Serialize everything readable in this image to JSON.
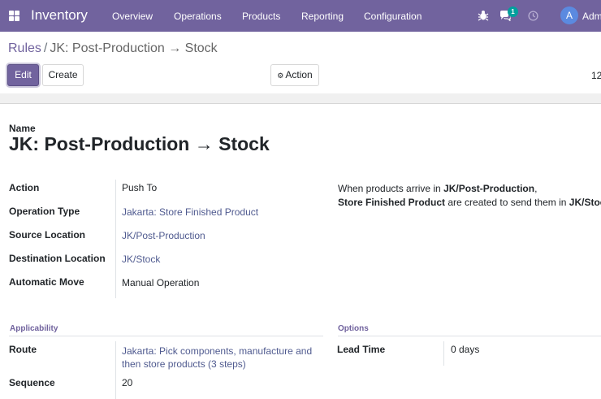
{
  "topbar": {
    "app_name": "Inventory",
    "menu": [
      "Overview",
      "Operations",
      "Products",
      "Reporting",
      "Configuration"
    ],
    "messages_badge": "1",
    "avatar_initial": "A",
    "user_name": "Adm"
  },
  "breadcrumb": {
    "parent": "Rules",
    "separator": "/",
    "current": "JK: Post-Production → Stock"
  },
  "toolbar": {
    "edit_label": "Edit",
    "create_label": "Create",
    "action_label": "Action",
    "pager_text": "12"
  },
  "form": {
    "name_label": "Name",
    "name_value": "JK: Post-Production → Stock",
    "fields": {
      "action": {
        "label": "Action",
        "value": "Push To"
      },
      "operation_type": {
        "label": "Operation Type",
        "value": "Jakarta: Store Finished Product"
      },
      "source_location": {
        "label": "Source Location",
        "value": "JK/Post-Production"
      },
      "destination_location": {
        "label": "Destination Location",
        "value": "JK/Stock"
      },
      "automatic_move": {
        "label": "Automatic Move",
        "value": "Manual Operation"
      }
    },
    "help": {
      "part1": "When products arrive in ",
      "src": "JK/Post-Production",
      "part2": ",",
      "product": "Store Finished Product",
      "part3": " are created to send them in ",
      "dest": "JK/Stock",
      "part4": "."
    },
    "applicability": {
      "title": "Applicability",
      "route_label": "Route",
      "route_line1": "Jakarta: Pick components, manufacture and",
      "route_line2": "then store products (3 steps)",
      "sequence_label": "Sequence",
      "sequence_value": "20"
    },
    "options": {
      "title": "Options",
      "lead_time_label": "Lead Time",
      "lead_time_value": "0 days"
    }
  },
  "colors": {
    "brand": "#71639e",
    "link": "#4f5a8f",
    "badge": "#00a09d",
    "avatar": "#5b8ae0"
  }
}
